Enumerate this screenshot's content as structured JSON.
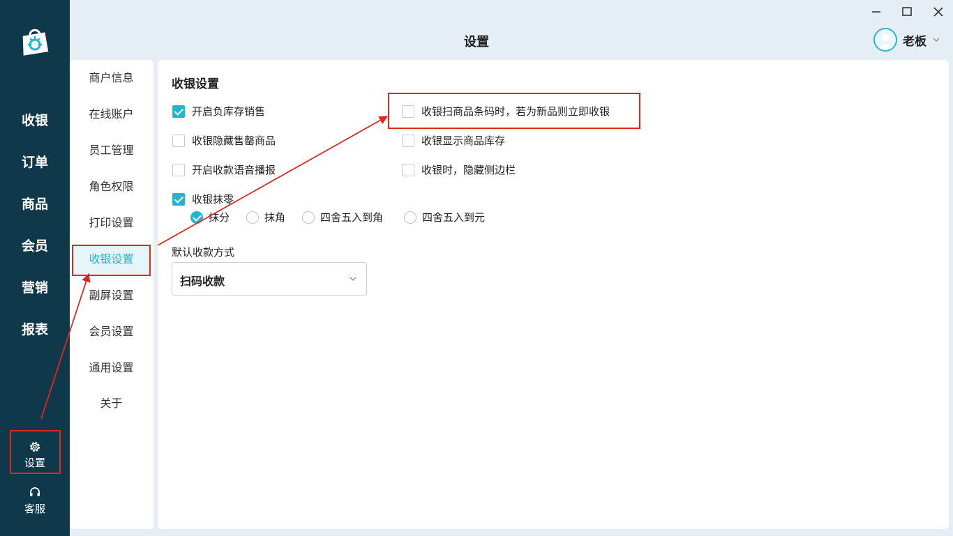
{
  "window": {
    "title": "设置",
    "controls": [
      "minimize-icon",
      "maximize-icon",
      "close-icon"
    ]
  },
  "user": {
    "name": "老板"
  },
  "sidebar": {
    "items": [
      {
        "label": "收银"
      },
      {
        "label": "订单"
      },
      {
        "label": "商品"
      },
      {
        "label": "会员"
      },
      {
        "label": "营销"
      },
      {
        "label": "报表"
      }
    ],
    "bottom": [
      {
        "label": "设置",
        "icon": "gear-icon"
      },
      {
        "label": "客服",
        "icon": "headset-icon"
      }
    ]
  },
  "menu": {
    "items": [
      {
        "label": "商户信息"
      },
      {
        "label": "在线账户"
      },
      {
        "label": "员工管理"
      },
      {
        "label": "角色权限"
      },
      {
        "label": "打印设置"
      },
      {
        "label": "收银设置",
        "active": true
      },
      {
        "label": "副屏设置"
      },
      {
        "label": "会员设置"
      },
      {
        "label": "通用设置"
      },
      {
        "label": "关于"
      }
    ]
  },
  "content": {
    "title": "收银设置",
    "options": [
      {
        "label": "开启负库存销售",
        "checked": true
      },
      {
        "label": "收银扫商品条码时，若为新品则立即收银",
        "checked": false
      },
      {
        "label": "收银隐藏售罄商品",
        "checked": false
      },
      {
        "label": "收银显示商品库存",
        "checked": false
      },
      {
        "label": "开启收款语音播报",
        "checked": false
      },
      {
        "label": "收银时，隐藏侧边栏",
        "checked": false
      },
      {
        "label": "收银抹零",
        "checked": true
      }
    ],
    "rounding": {
      "options": [
        "抹分",
        "抹角",
        "四舍五入到角",
        "四舍五入到元"
      ],
      "selected": "抹分"
    },
    "payment": {
      "label": "默认收款方式",
      "value": "扫码收款"
    }
  },
  "colors": {
    "sidebar_bg": "#10384b",
    "accent": "#21b6cc",
    "annotation": "#e0261f",
    "page_bg": "#e4eef4"
  }
}
